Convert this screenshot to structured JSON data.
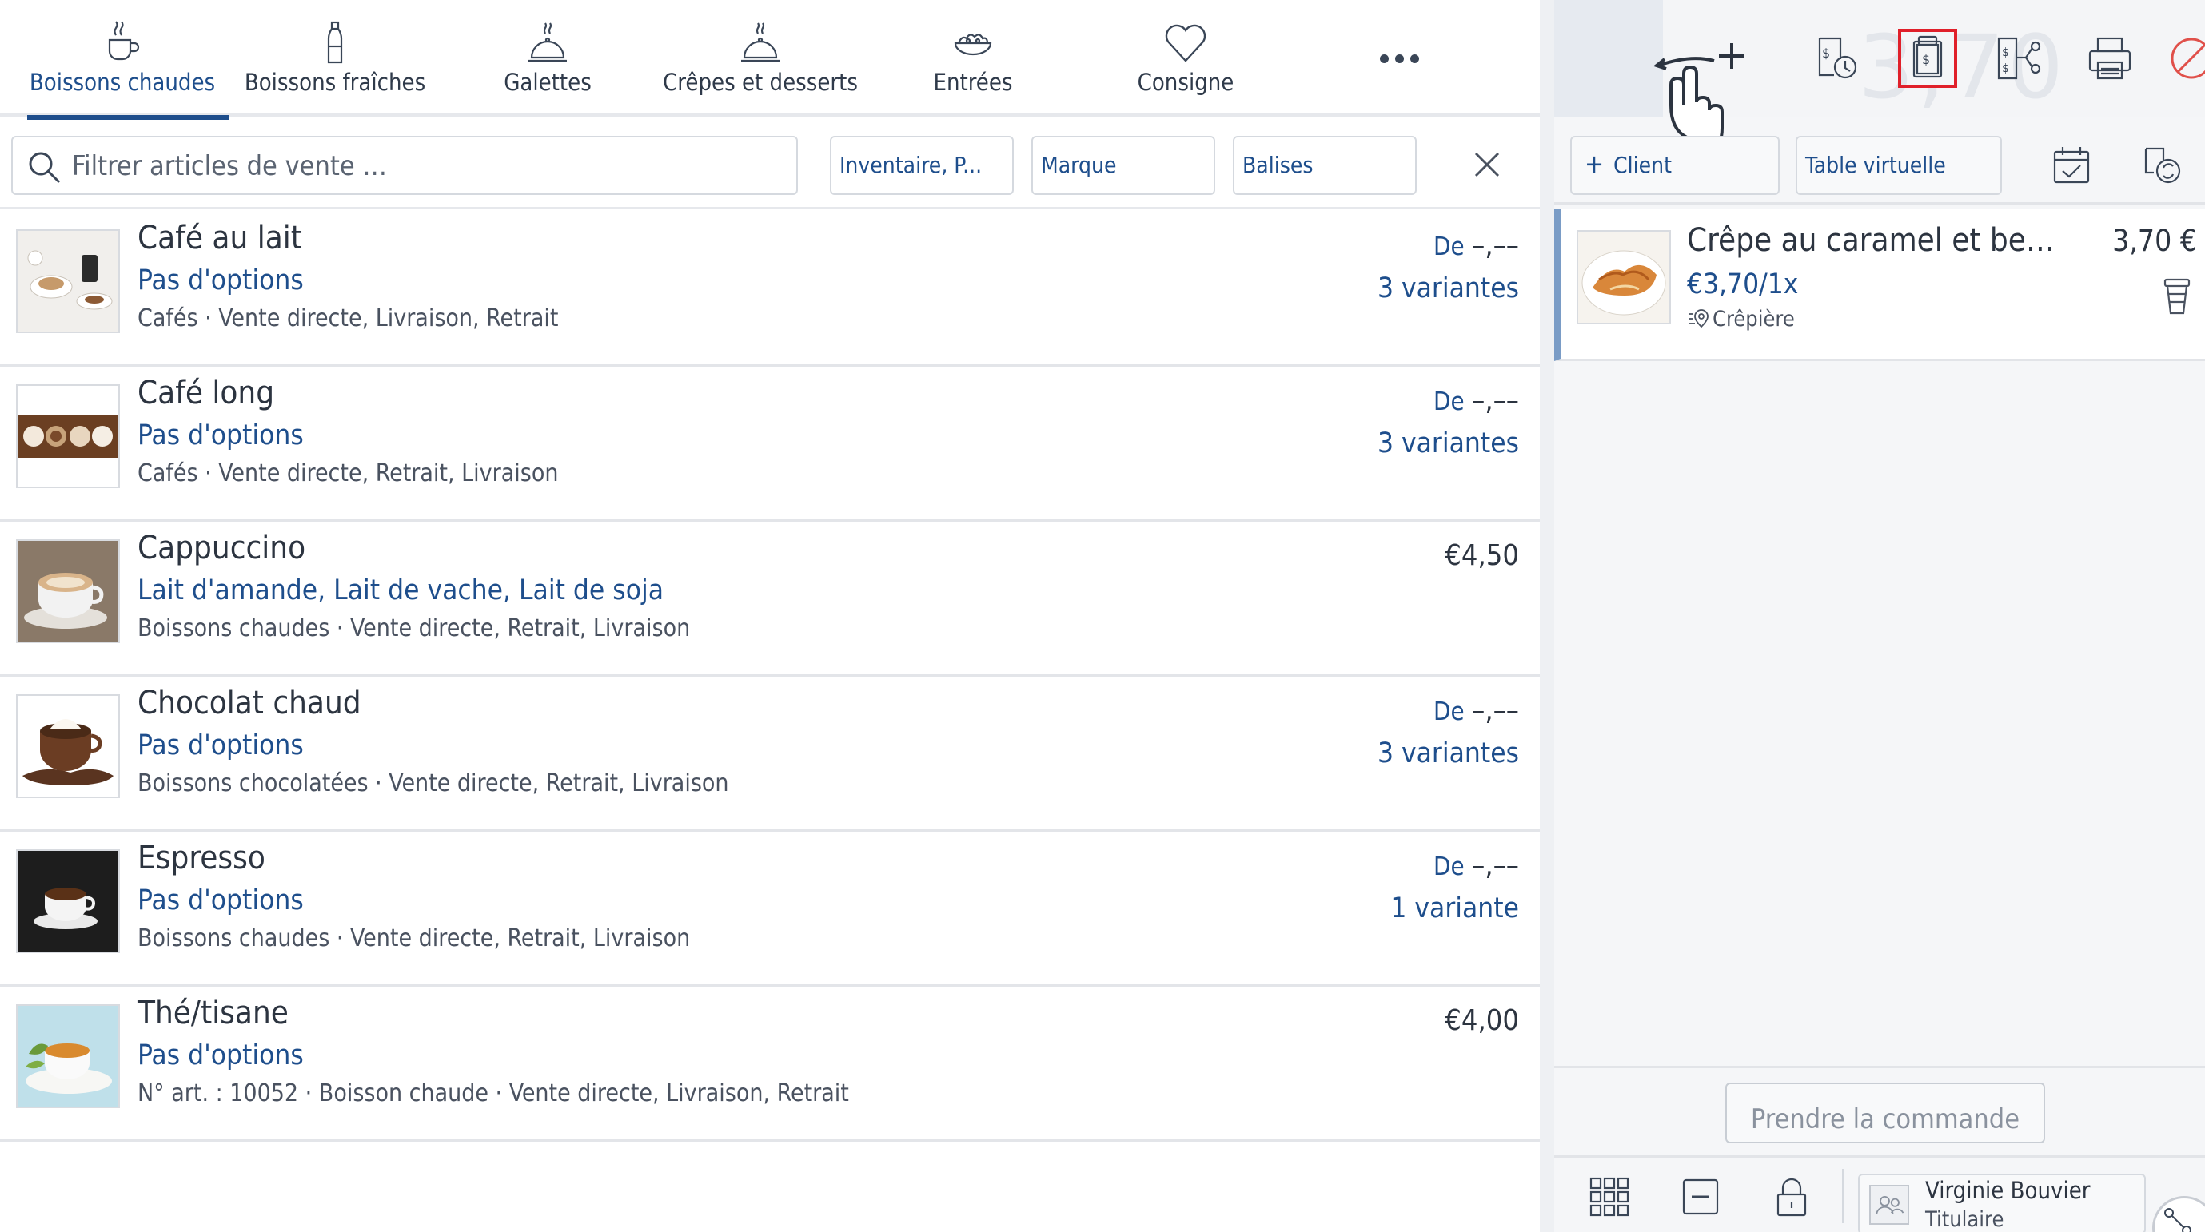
{
  "categories": [
    {
      "label": "Boissons chaudes",
      "icon": "hot-cup-icon",
      "active": true
    },
    {
      "label": "Boissons fraîches",
      "icon": "bottle-icon",
      "active": false
    },
    {
      "label": "Galettes",
      "icon": "cloche-icon",
      "active": false
    },
    {
      "label": "Crêpes et desserts",
      "icon": "cloche-icon",
      "active": false
    },
    {
      "label": "Entrées",
      "icon": "salad-icon",
      "active": false
    },
    {
      "label": "Consigne",
      "icon": "heart-icon",
      "active": false
    }
  ],
  "filters": {
    "search_placeholder": "Filtrer articles de vente …",
    "chip_inventory": "Inventaire, P...",
    "chip_brand": "Marque",
    "chip_tags": "Balises"
  },
  "articles": [
    {
      "name": "Café au lait",
      "options": "Pas d'options",
      "meta": "Cafés · Vente directe, Livraison, Retrait",
      "price_prefix": "De",
      "price": "–,––",
      "variants": "3 variantes",
      "thumb": "cafe-au-lait"
    },
    {
      "name": "Café long",
      "options": "Pas d'options",
      "meta": "Cafés · Vente directe, Retrait, Livraison",
      "price_prefix": "De",
      "price": "–,––",
      "variants": "3 variantes",
      "thumb": "cafe-long"
    },
    {
      "name": "Cappuccino",
      "options": "Lait d'amande, Lait de vache, Lait de soja",
      "meta": "Boissons chaudes · Vente directe, Retrait, Livraison",
      "price_prefix": "",
      "price": "€4,50",
      "variants": "",
      "thumb": "cappuccino"
    },
    {
      "name": "Chocolat chaud",
      "options": "Pas d'options",
      "meta": "Boissons chocolatées · Vente directe, Retrait, Livraison",
      "price_prefix": "De",
      "price": "–,––",
      "variants": "3 variantes",
      "thumb": "chocolat"
    },
    {
      "name": "Espresso",
      "options": "Pas d'options",
      "meta": "Boissons chaudes · Vente directe, Retrait, Livraison",
      "price_prefix": "De",
      "price": "–,––",
      "variants": "1 variante",
      "thumb": "espresso"
    },
    {
      "name": "Thé/tisane",
      "options": "Pas d'options",
      "meta": "N° art. : 10052 · Boisson chaude · Vente directe, Livraison, Retrait",
      "price_prefix": "",
      "price": "€4,00",
      "variants": "",
      "thumb": "the"
    }
  ],
  "toolbar": {
    "ghost_total": "3,70",
    "icons": [
      "add-icon",
      "clock-receipt-icon",
      "receipt-clipboard-icon",
      "split-receipt-icon",
      "printer-icon",
      "cancel-icon"
    ]
  },
  "client_bar": {
    "client_label": "Client",
    "table_label": "Table virtuelle"
  },
  "order": {
    "items": [
      {
        "name": "Crêpe au caramel et beurre...",
        "price": "3,70 €",
        "unit": "€3,70/1x",
        "location": "Crêpière"
      }
    ]
  },
  "footer": {
    "take_order_label": "Prendre la commande"
  },
  "user": {
    "name": "Virginie Bouvier",
    "role": "Titulaire"
  },
  "colors": {
    "accent": "#1e4e8c",
    "highlight": "#e0202a",
    "divider": "#e3e5e9"
  }
}
